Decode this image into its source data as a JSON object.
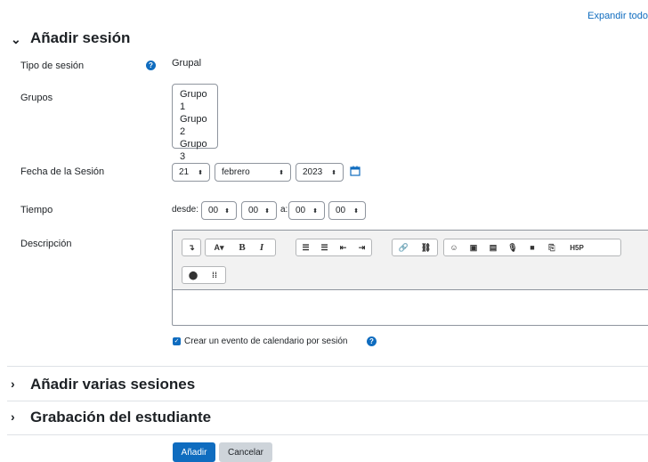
{
  "expand_all": "Expandir todo",
  "section1": {
    "title": "Añadir sesión",
    "tipo_label": "Tipo de sesión",
    "tipo_value": "Grupal",
    "grupos_label": "Grupos",
    "grupos": [
      "Grupo 1",
      "Grupo 2",
      "Grupo 3"
    ],
    "fecha_label": "Fecha de la Sesión",
    "fecha_day": "21",
    "fecha_month": "febrero",
    "fecha_year": "2023",
    "tiempo_label": "Tiempo",
    "desde": "desde:",
    "from_hour": "00",
    "from_min": "00",
    "a": "a:",
    "to_hour": "00",
    "to_min": "00",
    "descripcion_label": "Descripción",
    "calendar_check_label": "Crear un evento de calendario por sesión"
  },
  "section2": {
    "title": "Añadir varias sesiones"
  },
  "section3": {
    "title": "Grabación del estudiante"
  },
  "buttons": {
    "submit": "Añadir",
    "cancel": "Cancelar"
  },
  "colors": {
    "accent": "#0f6cbf",
    "secondary": "#ced4da"
  }
}
